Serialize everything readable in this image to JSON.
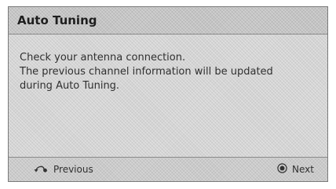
{
  "dialog": {
    "title": "Auto Tuning",
    "message_lines": [
      "Check your antenna connection.",
      "The previous channel information will be updated",
      "during Auto Tuning."
    ]
  },
  "footer": {
    "previous": {
      "label": "Previous",
      "icon": "return-arrow-icon"
    },
    "next": {
      "label": "Next",
      "icon": "enter-button-icon"
    }
  }
}
